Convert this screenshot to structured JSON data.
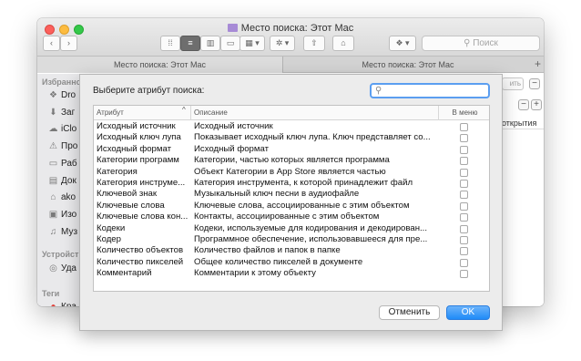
{
  "window": {
    "title": "Место поиска: Этот Mac",
    "nav_back": "‹",
    "nav_forward": "›",
    "search_placeholder": "Поиск",
    "tabs": [
      "Место поиска: Этот Mac",
      "Место поиска: Этот Mac"
    ],
    "tab_add": "+"
  },
  "sidebar": {
    "favorites_header": "Избранно",
    "items": [
      {
        "icon": "dropbox-icon",
        "glyph": "❖",
        "label": "Dro"
      },
      {
        "icon": "download-icon",
        "glyph": "⬇",
        "label": "Заг"
      },
      {
        "icon": "icloud-icon",
        "glyph": "☁",
        "label": "iClo"
      },
      {
        "icon": "applications-icon",
        "glyph": "⚠",
        "label": "Про"
      },
      {
        "icon": "desktop-icon",
        "glyph": "▭",
        "label": "Раб"
      },
      {
        "icon": "documents-icon",
        "glyph": "▤",
        "label": "Док"
      },
      {
        "icon": "home-icon",
        "glyph": "⌂",
        "label": "ako"
      },
      {
        "icon": "pictures-icon",
        "glyph": "▣",
        "label": "Изо"
      },
      {
        "icon": "music-icon",
        "glyph": "♫",
        "label": "Муз"
      }
    ],
    "devices_header": "Устройств",
    "device_items": [
      {
        "icon": "remote-disc-icon",
        "glyph": "◎",
        "label": "Уда"
      }
    ],
    "tags_header": "Теги",
    "tag_items": [
      {
        "icon": "tag-red-icon",
        "glyph": "●",
        "label": "Кра",
        "color": "#e0443e"
      }
    ]
  },
  "finder_right": {
    "save_label": "ить",
    "minus": "−",
    "plus": "+",
    "column_header": "открытия"
  },
  "dialog": {
    "prompt": "Выберите атрибут поиска:",
    "search_value": "",
    "columns": {
      "attribute": "Атрибут",
      "description": "Описание",
      "in_menu": "В меню"
    },
    "sort_indicator": "^",
    "rows": [
      {
        "attribute": "Исходный источник",
        "description": "Исходный источник",
        "in_menu": false
      },
      {
        "attribute": "Исходный ключ лупа",
        "description": "Показывает исходный ключ лупа. Ключ представляет со...",
        "in_menu": false
      },
      {
        "attribute": "Исходный формат",
        "description": "Исходный формат",
        "in_menu": false
      },
      {
        "attribute": "Категории программ",
        "description": "Категории, частью которых является программа",
        "in_menu": false
      },
      {
        "attribute": "Категория",
        "description": "Объект Категории в App Store является частью",
        "in_menu": false
      },
      {
        "attribute": "Категория инструме...",
        "description": "Категория инструмента, к которой принадлежит файл",
        "in_menu": false
      },
      {
        "attribute": "Ключевой знак",
        "description": "Музыкальный ключ песни в аудиофайле",
        "in_menu": false
      },
      {
        "attribute": "Ключевые слова",
        "description": "Ключевые слова, ассоциированные с этим объектом",
        "in_menu": false
      },
      {
        "attribute": "Ключевые слова кон...",
        "description": "Контакты, ассоциированные с этим объектом",
        "in_menu": false
      },
      {
        "attribute": "Кодеки",
        "description": "Кодеки, используемые для кодирования и декодирован...",
        "in_menu": false
      },
      {
        "attribute": "Кодер",
        "description": "Программное обеспечение, использовавшееся для пре...",
        "in_menu": false
      },
      {
        "attribute": "Количество объектов",
        "description": "Количество файлов и папок в папке",
        "in_menu": false
      },
      {
        "attribute": "Количество пикселей",
        "description": "Общее количество пикселей в документе",
        "in_menu": false
      },
      {
        "attribute": "Комментарий",
        "description": "Комментарии к этому объекту",
        "in_menu": false
      }
    ],
    "cancel_label": "Отменить",
    "ok_label": "OK",
    "accent_color": "#1f8bf8"
  }
}
